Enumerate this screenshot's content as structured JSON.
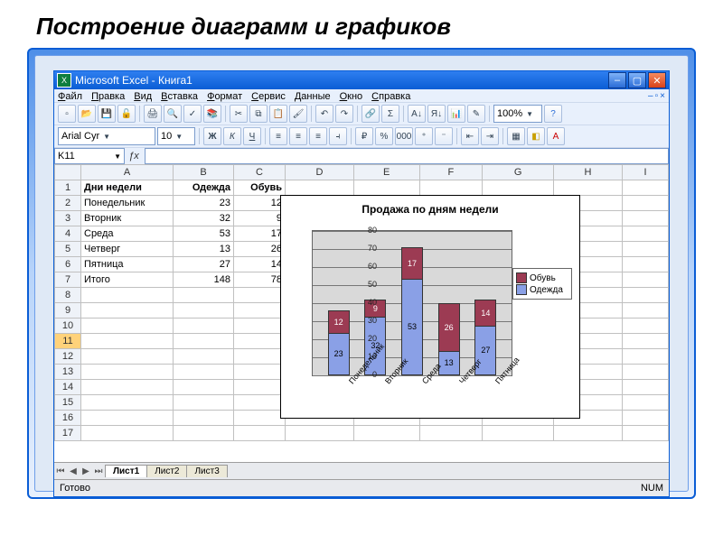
{
  "page_heading": "Построение диаграмм и графиков",
  "window": {
    "title": "Microsoft Excel - Книга1"
  },
  "menu": [
    "Файл",
    "Правка",
    "Вид",
    "Вставка",
    "Формат",
    "Сервис",
    "Данные",
    "Окно",
    "Справка"
  ],
  "toolbar1": {
    "zoom": "100%",
    "icons": [
      "new",
      "open",
      "save",
      "permission",
      "print",
      "preview",
      "spell",
      "research",
      "cut",
      "copy",
      "paste",
      "format-painter",
      "undo",
      "redo",
      "hyperlink",
      "autosum",
      "sort-asc",
      "sort-desc",
      "chart-wizard",
      "drawing"
    ]
  },
  "toolbar2": {
    "font": "Arial Cyr",
    "size": "10",
    "btns": [
      "Ж",
      "К",
      "Ч"
    ]
  },
  "namebox": "K11",
  "columns": [
    "A",
    "B",
    "C",
    "D",
    "E",
    "F",
    "G",
    "H",
    "I"
  ],
  "table": {
    "headers": [
      "Дни недели",
      "Одежда",
      "Обувь"
    ],
    "rows": [
      [
        "Понедельник",
        "23",
        "12"
      ],
      [
        "Вторник",
        "32",
        "9"
      ],
      [
        "Среда",
        "53",
        "17"
      ],
      [
        "Четверг",
        "13",
        "26"
      ],
      [
        "Пятница",
        "27",
        "14"
      ],
      [
        "Итого",
        "148",
        "78"
      ]
    ]
  },
  "chart_data": {
    "type": "bar",
    "stacked": true,
    "title": "Продажа по дням недели",
    "categories": [
      "Понедельник",
      "Вторник",
      "Среда",
      "Четверг",
      "Пятница"
    ],
    "series": [
      {
        "name": "Одежда",
        "values": [
          23,
          32,
          53,
          13,
          27
        ],
        "color": "#8aa0e6"
      },
      {
        "name": "Обувь",
        "values": [
          12,
          9,
          17,
          26,
          14
        ],
        "color": "#9c3b53"
      }
    ],
    "ylim": [
      0,
      80
    ],
    "yticks": [
      0,
      10,
      20,
      30,
      40,
      50,
      60,
      70,
      80
    ],
    "xlabel": "",
    "ylabel": ""
  },
  "legend_order": [
    "Обувь",
    "Одежда"
  ],
  "sheets": {
    "active": "Лист1",
    "tabs": [
      "Лист1",
      "Лист2",
      "Лист3"
    ]
  },
  "statusbar": {
    "left": "Готово",
    "right": "NUM"
  },
  "selected_row": 11,
  "row_count": 17
}
